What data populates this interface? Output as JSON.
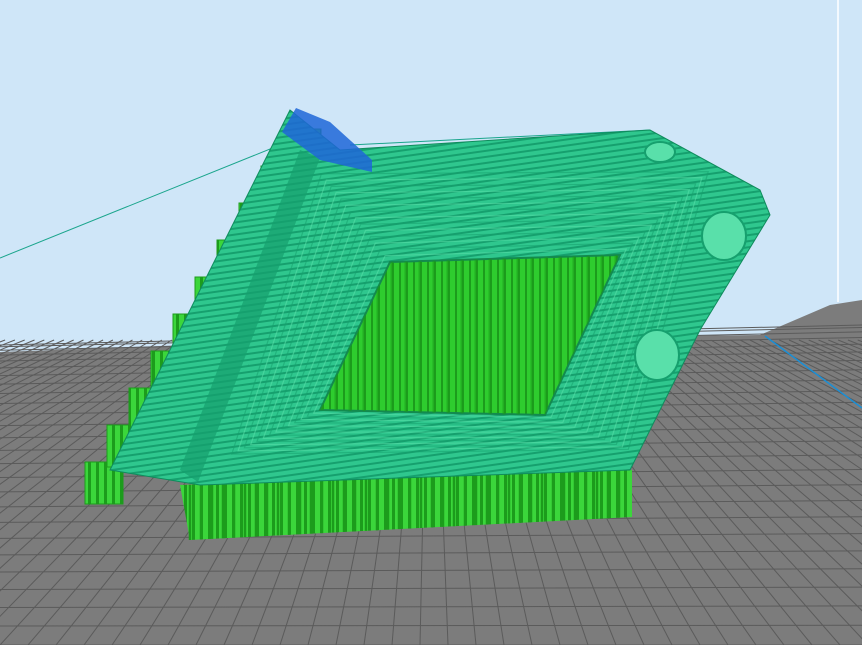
{
  "viewport": {
    "kind": "3d-slicer-gcode-preview",
    "background_color": "#cfe6f8",
    "build_plate": {
      "color": "#7c7c7c",
      "grid_line_color": "#5b5b5b",
      "grid": true
    },
    "model": {
      "shape": "tilted rectangular frame with rectangular opening, two round holes and stepped side supports",
      "colors": {
        "wall": "#2fc78e",
        "wall_light": "#59e0aa",
        "wall_dark": "#16a06e",
        "infill": "#2ecc2e",
        "infill_dark": "#1c9c1c",
        "support": "#3bd63b",
        "overhang_blue": "#1e66d8"
      }
    },
    "axes": {
      "x_color": "#1a8fd6",
      "guide_line_color": "#1aa58c"
    }
  }
}
